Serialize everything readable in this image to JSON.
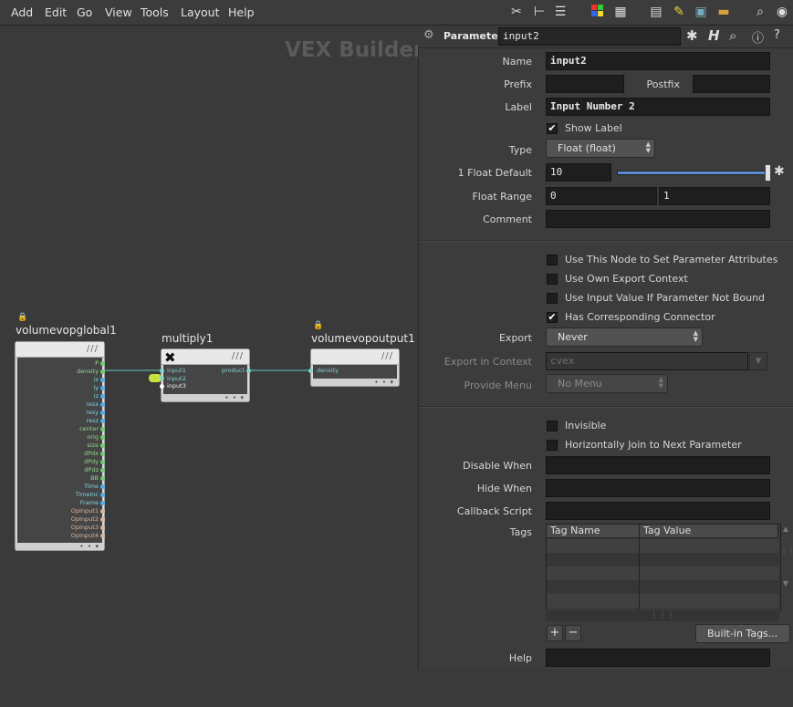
{
  "menubar": {
    "items": [
      "Add",
      "Edit",
      "Go",
      "View",
      "Tools",
      "Layout",
      "Help"
    ]
  },
  "toolbar_icons": [
    "tools-icon",
    "tree-icon",
    "list-icon",
    "color-palette-icon",
    "grid-icon",
    "network-view-icon",
    "sticky-note-icon",
    "image-icon",
    "box-icon",
    "search-icon",
    "eye-icon"
  ],
  "network": {
    "context_title": "VEX Builder",
    "nodes": {
      "global": {
        "name": "volumevopglobal1",
        "outputs": [
          "P",
          "density",
          "ix",
          "iy",
          "iz",
          "resx",
          "resy",
          "resz",
          "center",
          "orig",
          "size",
          "dPdx",
          "dPdy",
          "dPdz",
          "BB",
          "Time",
          "TimeInc",
          "Frame",
          "OpInput1",
          "OpInput2",
          "OpInput3",
          "OpInput4"
        ]
      },
      "multiply": {
        "name": "multiply1",
        "inputs": [
          "input1",
          "input2",
          "input3"
        ],
        "output": "product"
      },
      "output": {
        "name": "volumevopoutput1",
        "input": "density"
      }
    }
  },
  "panel": {
    "header_label": "Parameter",
    "node_path": "input2",
    "name_label": "Name",
    "name_value": "input2",
    "prefix_label": "Prefix",
    "postfix_label": "Postfix",
    "label_label": "Label",
    "label_value": "Input Number 2",
    "show_label": "Show Label",
    "show_label_checked": true,
    "type_label": "Type",
    "type_value": "Float (float)",
    "float_default_label": "1 Float Default",
    "float_default_value": "10",
    "float_default_slider_fraction": 1.0,
    "float_range_label": "Float Range",
    "float_range_min": "0",
    "float_range_max": "1",
    "comment_label": "Comment",
    "checks": [
      {
        "label": "Use This Node to Set Parameter Attributes",
        "checked": false
      },
      {
        "label": "Use Own Export Context",
        "checked": false
      },
      {
        "label": "Use Input Value If Parameter Not Bound",
        "checked": false
      },
      {
        "label": "Has Corresponding Connector",
        "checked": true
      }
    ],
    "export_label": "Export",
    "export_value": "Never",
    "export_context_label": "Export in Context",
    "export_context_value": "cvex",
    "provide_menu_label": "Provide Menu",
    "provide_menu_value": "No Menu",
    "invisible_label": "Invisible",
    "hjoin_label": "Horizontally Join to Next Parameter",
    "disable_when_label": "Disable When",
    "hide_when_label": "Hide When",
    "callback_label": "Callback Script",
    "tags_label": "Tags",
    "tags_columns": [
      "Tag Name",
      "Tag Value"
    ],
    "add_symbol": "+",
    "remove_symbol": "−",
    "builtin_tags_label": "Built-in Tags...",
    "help_label": "Help"
  },
  "annotation": {
    "mark": "√",
    "color": "#d02020"
  }
}
